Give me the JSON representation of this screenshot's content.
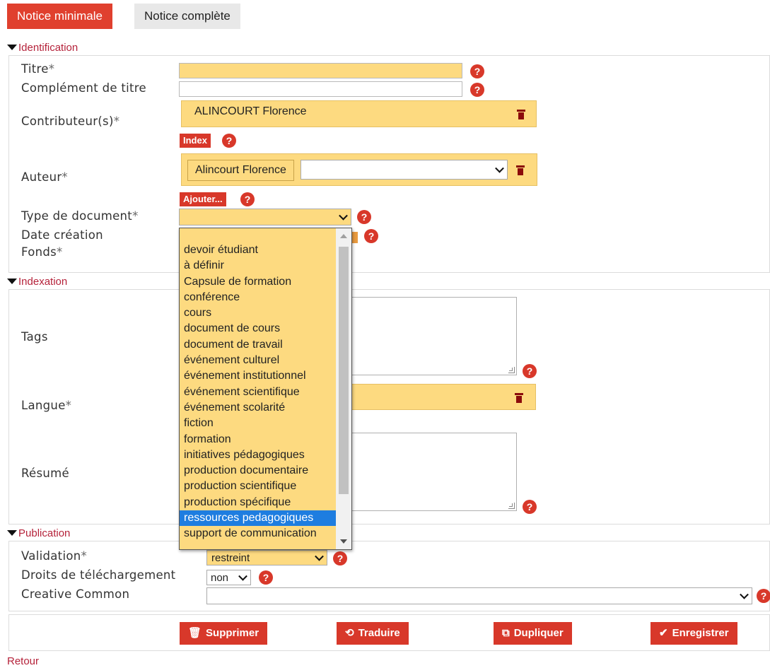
{
  "tabs": {
    "active": "Notice minimale",
    "inactive": "Notice complète"
  },
  "sections": {
    "identification": "Identification",
    "indexation": "Indexation",
    "publication": "Publication"
  },
  "labels": {
    "titre": "Titre",
    "complement": "Complément de titre",
    "contributeurs": "Contributeur(s)",
    "auteur": "Auteur",
    "type_document": "Type de document",
    "date_creation": "Date création",
    "fonds": "Fonds",
    "tags": "Tags",
    "langue": "Langue",
    "resume": "Résumé",
    "validation": "Validation",
    "droits": "Droits de téléchargement",
    "creative": "Creative Common",
    "required_mark": "*"
  },
  "help_glyph": "?",
  "contributeur": {
    "name": "ALINCOURT Florence",
    "index_button": "Index"
  },
  "auteur": {
    "name": "Alincourt Florence",
    "add_button": "Ajouter..."
  },
  "validation_value": "restreint",
  "droits_value": "non",
  "dropdown_options": [
    "devoir étudiant",
    "à définir",
    "Capsule de formation",
    "conférence",
    "cours",
    "document de cours",
    "document de travail",
    "événement culturel",
    "événement institutionnel",
    "événement scientifique",
    "événement scolarité",
    "fiction",
    "formation",
    "initiatives pédagogiques",
    "production documentaire",
    "production scientifique",
    "production spécifique",
    "ressources pedagogiques",
    "support de communication"
  ],
  "dropdown_selected_index": 17,
  "actions": {
    "supprimer": "Supprimer",
    "traduire": "Traduire",
    "dupliquer": "Dupliquer",
    "enregistrer": "Enregistrer"
  },
  "icons": {
    "supprimer": "trash-icon",
    "traduire": "translate-icon",
    "dupliquer": "copy-icon",
    "enregistrer": "check-icon",
    "ico_supprimer": "🗑",
    "ico_traduire": "⟲",
    "ico_dupliquer": "⧉",
    "ico_enregistrer": "✔"
  },
  "retour": "Retour",
  "colors": {
    "accent": "#d8382a",
    "field_yellow": "#fdda80",
    "section": "#b5223a",
    "selection": "#1e7de0"
  }
}
